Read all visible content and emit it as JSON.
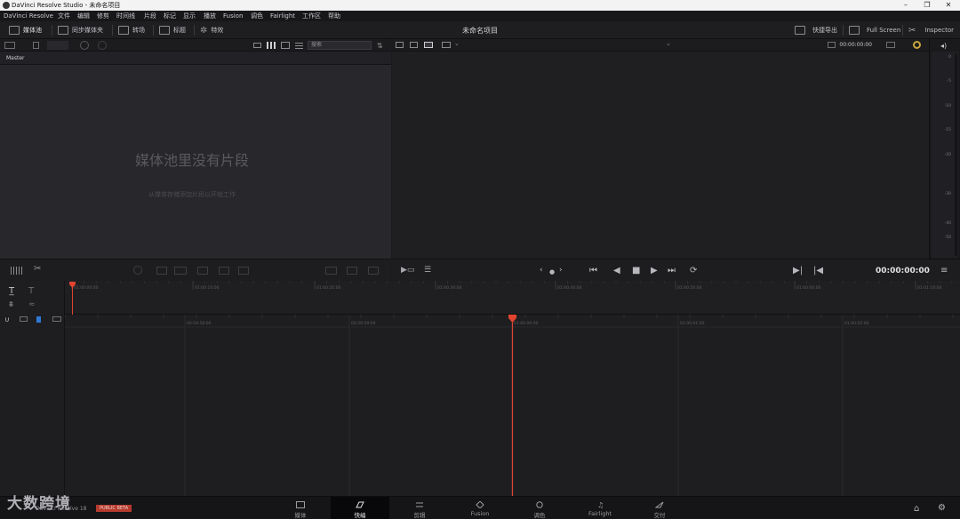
{
  "window": {
    "title": "DaVinci Resolve Studio - 未命名项目",
    "controls": [
      "–",
      "❐",
      "✕"
    ]
  },
  "menu": [
    "DaVinci Resolve",
    "文件",
    "编辑",
    "修剪",
    "时间线",
    "片段",
    "标记",
    "显示",
    "播放",
    "Fusion",
    "调色",
    "Fairlight",
    "工作区",
    "帮助"
  ],
  "toolbar": {
    "media_pool": "媒体池",
    "sync_bin": "同步媒体夹",
    "transitions": "转场",
    "titles": "标题",
    "effects": "特效",
    "project_title": "未命名项目",
    "quick_export": "快捷导出",
    "full_screen": "Full Screen",
    "inspector": "Inspector"
  },
  "media_pool": {
    "search_placeholder": "搜索",
    "bin": "Master",
    "empty_title": "媒体池里没有片段",
    "empty_sub": "从媒体存储添加片段以开始工作"
  },
  "viewer": {
    "timecode_top": "00:00:00:00",
    "timecode": "00:00:00:00"
  },
  "meter_scale": [
    "0",
    "-5",
    "-10",
    "-15",
    "-20",
    "-30",
    "-40",
    "-50"
  ],
  "timeline": {
    "upper_ruler": [
      "01:00:00:00",
      "01:00:10:00",
      "01:00:20:00",
      "01:00:30:00",
      "01:00:40:00",
      "01:00:50:00",
      "01:00:00:00",
      "01:01:10:00"
    ],
    "lower_ruler": [
      "00:59:58:00",
      "00:59:59:00",
      "01:00:00:00",
      "01:00:01:00",
      "01:00:02:00"
    ]
  },
  "pages": [
    {
      "label": "媒体",
      "icon": "media-icon"
    },
    {
      "label": "快编",
      "icon": "cut-icon",
      "active": true
    },
    {
      "label": "剪辑",
      "icon": "edit-icon"
    },
    {
      "label": "Fusion",
      "icon": "fusion-icon"
    },
    {
      "label": "调色",
      "icon": "color-icon"
    },
    {
      "label": "Fairlight",
      "icon": "fairlight-icon"
    },
    {
      "label": "交付",
      "icon": "deliver-icon"
    }
  ],
  "brand": {
    "app_name": "DaVinci Resolve 18",
    "badge": "PUBLIC BETA",
    "watermark": "大数跨境"
  },
  "colors": {
    "playhead": "#e0432f",
    "accent": "#b63b2e"
  }
}
